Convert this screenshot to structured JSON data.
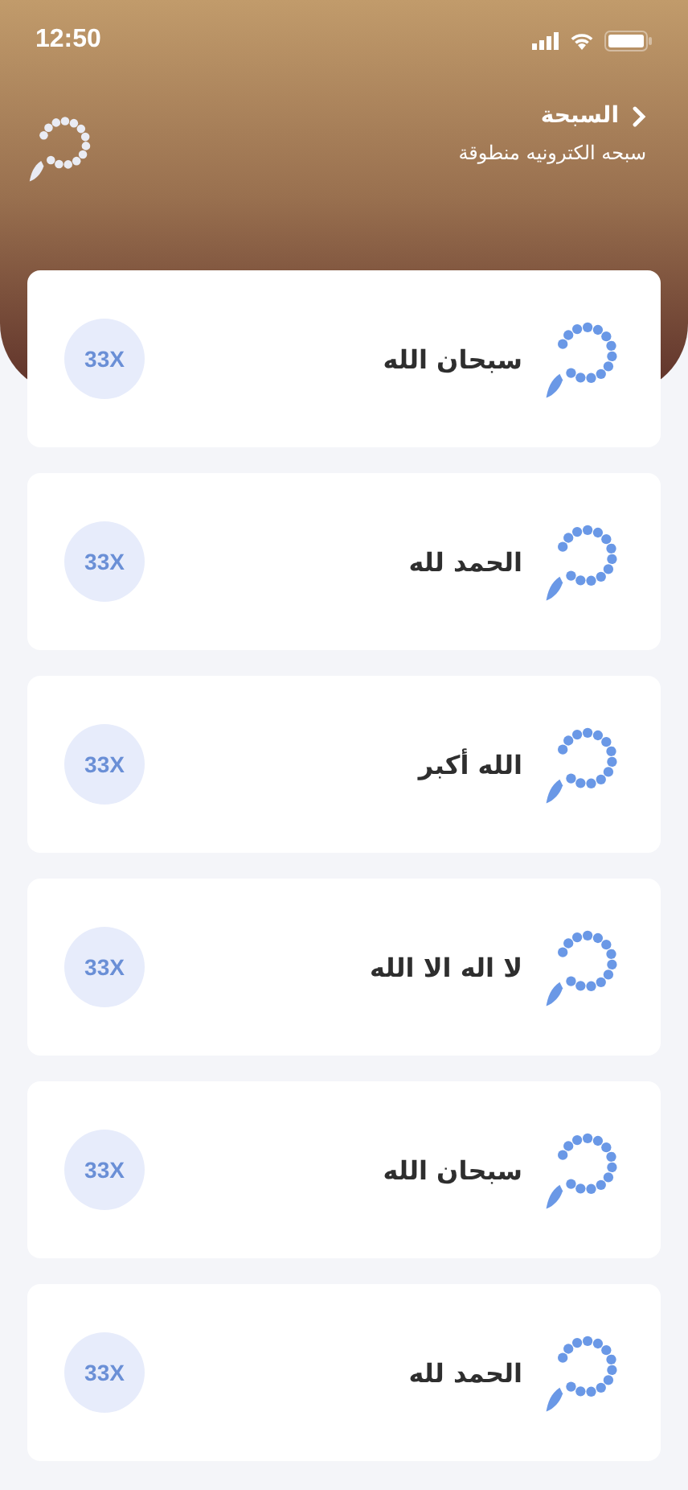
{
  "status_bar": {
    "time": "12:50"
  },
  "header": {
    "title": "السبحة",
    "subtitle": "سبحه الكترونيه منطوقة"
  },
  "dhikr_items": [
    {
      "text": "سبحان الله",
      "count": "33X"
    },
    {
      "text": "الحمد لله",
      "count": "33X"
    },
    {
      "text": "الله أكبر",
      "count": "33X"
    },
    {
      "text": "لا اله الا الله",
      "count": "33X"
    },
    {
      "text": "سبحان الله",
      "count": "33X"
    },
    {
      "text": "الحمد لله",
      "count": "33X"
    }
  ]
}
